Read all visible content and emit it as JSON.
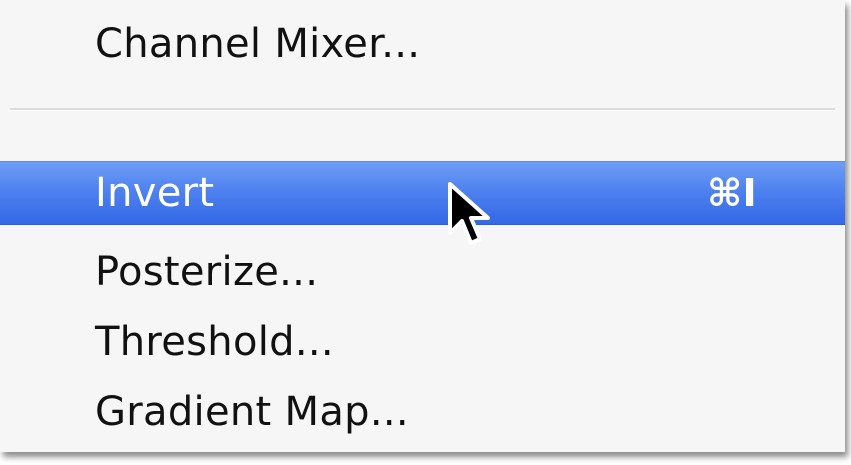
{
  "menu": {
    "items": [
      {
        "label": "Channel Mixer..."
      },
      {
        "label": "Invert",
        "shortcut": "⌘I",
        "highlighted": true
      },
      {
        "label": "Posterize..."
      },
      {
        "label": "Threshold..."
      },
      {
        "label": "Gradient Map..."
      }
    ]
  },
  "colors": {
    "menu_background": "#f6f6f6",
    "highlight": "#4f82ef",
    "text": "#111111",
    "highlight_text": "#ffffff"
  },
  "icons": {
    "cursor": "arrow-pointer-icon",
    "shortcut_modifier": "command-key-icon"
  }
}
